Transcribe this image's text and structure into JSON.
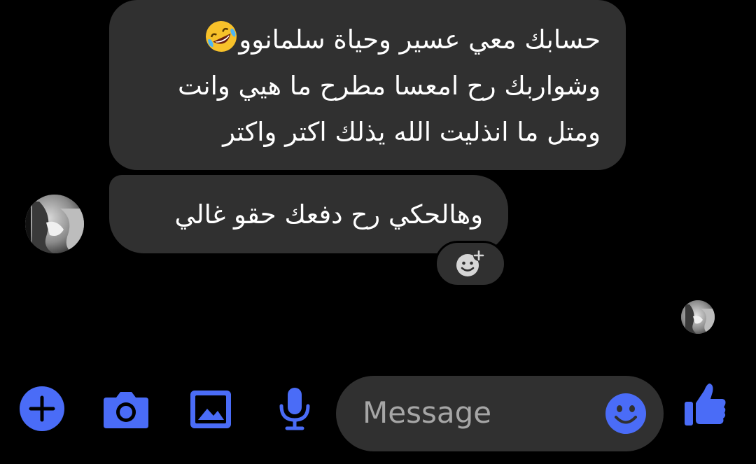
{
  "conversation": {
    "messages": [
      {
        "lines": [
          "حسابك معي عسير وحياة سلمانوو",
          "وشواربك رح امعسا مطرح ما هيي وانت",
          "ومتل ما انذليت الله يذلك اكتر واكتر"
        ],
        "trailing_emoji": "rolling-on-floor-laughing"
      },
      {
        "text": "وهالحكي رح دفعك حقو غالي"
      }
    ]
  },
  "composer": {
    "placeholder": "Message"
  },
  "icons": {
    "plus": "plus-icon",
    "camera": "camera-icon",
    "gallery": "image-icon",
    "mic": "microphone-icon",
    "emoji": "emoji-smile-icon",
    "like": "thumbs-up-icon",
    "add_reaction": "add-reaction-icon"
  },
  "colors": {
    "accent": "#4a6cf7",
    "bubble": "#303030",
    "background": "#000000"
  }
}
